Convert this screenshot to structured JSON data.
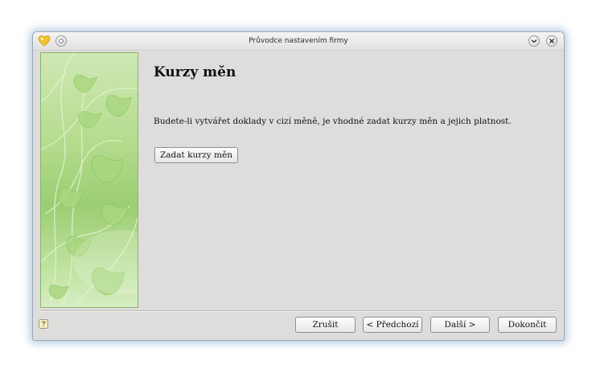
{
  "window": {
    "title": "Průvodce nastavením firmy"
  },
  "icons": {
    "app": "app-heart-icon",
    "minimize": "chevron-down-icon",
    "close": "close-icon",
    "menu": "window-menu-icon",
    "help": "help-icon"
  },
  "page": {
    "heading": "Kurzy měn",
    "description": "Budete-li vytvářet doklady v cizí měně, je vhodné zadat kurzy měn a jejich platnost.",
    "action_button": "Zadat kurzy měn"
  },
  "footer": {
    "cancel": "Zrušit",
    "previous": "< Předchozí",
    "next": "Další >",
    "finish": "Dokončit"
  },
  "colors": {
    "accent_green": "#9ccd73",
    "window_bg": "#dedddc"
  }
}
